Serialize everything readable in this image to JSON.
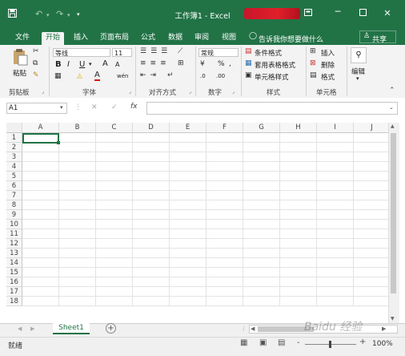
{
  "app": {
    "title": "工作簿1 - Excel",
    "title_icons": {
      "save": "save-icon",
      "undo": "undo-icon",
      "redo": "redo-icon",
      "customize": "customize-qat-icon"
    },
    "window": {
      "ribbon_display": "ribbon-display-icon",
      "minimize": "minimize-icon",
      "maximize": "maximize-icon",
      "close": "close-icon"
    },
    "accent": "#217346"
  },
  "tabs": [
    "文件",
    "开始",
    "插入",
    "页面布局",
    "公式",
    "数据",
    "审阅",
    "视图"
  ],
  "active_tab": "开始",
  "tell_me": "告诉我你想要做什么",
  "share": "共享",
  "ribbon": {
    "clipboard": {
      "paste": "粘贴",
      "label": "剪贴板"
    },
    "font": {
      "name": "等线",
      "size": "11",
      "bold": "B",
      "italic": "I",
      "underline": "U",
      "grow": "A",
      "shrink": "A",
      "font_color": "A",
      "phonetic": "wén",
      "label": "字体"
    },
    "alignment": {
      "label": "对齐方式"
    },
    "number": {
      "format": "常规",
      "percent": "%",
      "comma": ",",
      "inc_decimal": ".0",
      "dec_decimal": ".00",
      "label": "数字"
    },
    "styles": {
      "conditional": "条件格式",
      "table": "套用表格格式",
      "cell_styles": "单元格样式",
      "label": "样式"
    },
    "cells": {
      "insert": "插入",
      "delete": "删除",
      "format": "格式",
      "label": "单元格"
    },
    "editing": {
      "label": "编辑"
    }
  },
  "formula_bar": {
    "name_box": "A1",
    "cancel": "✕",
    "enter": "✓",
    "fx": "fx",
    "value": ""
  },
  "grid": {
    "columns": [
      "A",
      "B",
      "C",
      "D",
      "E",
      "F",
      "G",
      "H",
      "I",
      "J"
    ],
    "rows": [
      "1",
      "2",
      "3",
      "4",
      "5",
      "6",
      "7",
      "8",
      "9",
      "10",
      "11",
      "12",
      "13",
      "14",
      "15",
      "16",
      "17",
      "18"
    ],
    "selected_cell": "A1"
  },
  "sheets": {
    "tabs": [
      "Sheet1"
    ],
    "active": "Sheet1",
    "add": "+"
  },
  "status": {
    "mode": "就绪",
    "zoom": "100%",
    "zoom_minus": "-",
    "zoom_plus": "+"
  },
  "watermark": "Baidu 经验"
}
